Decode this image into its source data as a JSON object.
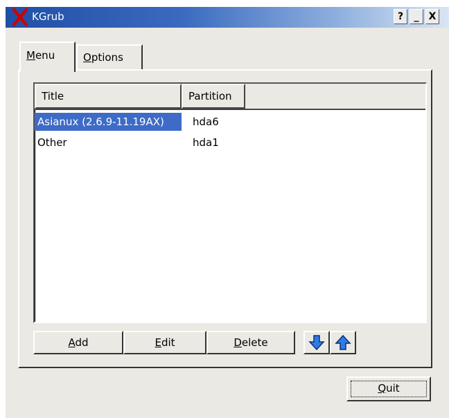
{
  "window": {
    "title": "KGrub",
    "help_label": "?",
    "minimize_label": "_",
    "close_label": "X"
  },
  "tabs": [
    {
      "label_first": "M",
      "label_rest": "enu",
      "active": true
    },
    {
      "label_first": "O",
      "label_rest": "ptions",
      "active": false
    }
  ],
  "table": {
    "columns": [
      "Title",
      "Partition"
    ],
    "rows": [
      {
        "title": "Asianux (2.6.9-11.19AX)",
        "partition": "hda6",
        "selected": true
      },
      {
        "title": "Other",
        "partition": "hda1",
        "selected": false
      }
    ]
  },
  "buttons": {
    "add_first": "A",
    "add_rest": "dd",
    "edit_first": "E",
    "edit_rest": "dit",
    "delete_first": "D",
    "delete_rest": "elete",
    "quit_first": "Q",
    "quit_rest": "uit"
  },
  "icons": {
    "app": "x-logo-icon",
    "move_down": "arrow-down-icon",
    "move_up": "arrow-up-icon"
  },
  "colors": {
    "title_bar": "#1f4fa6",
    "selection": "#3d6bc7",
    "arrow_blue": "#2f7be6",
    "app_icon_red": "#d00000"
  }
}
